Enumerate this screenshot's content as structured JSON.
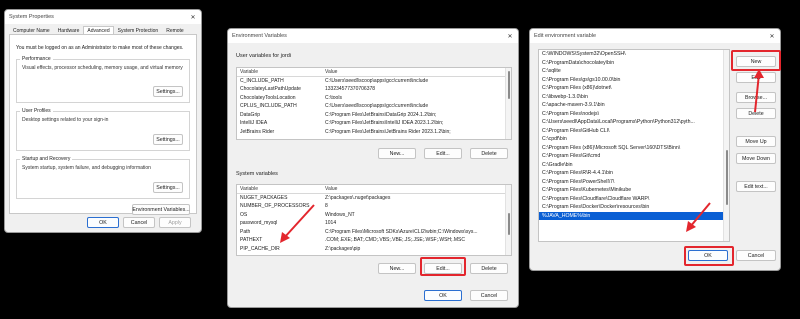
{
  "system_properties": {
    "title": "System Properties",
    "tabs": [
      "Computer Name",
      "Hardware",
      "Advanced",
      "System Protection",
      "Remote"
    ],
    "active_tab": "Advanced",
    "admin_note": "You must be logged on as an Administrator to make most of these changes.",
    "performance": {
      "title": "Performance",
      "desc": "Visual effects, processor scheduling, memory usage, and virtual memory",
      "button": "Settings..."
    },
    "user_profiles": {
      "title": "User Profiles",
      "desc": "Desktop settings related to your sign-in",
      "button": "Settings..."
    },
    "startup": {
      "title": "Startup and Recovery",
      "desc": "System startup, system failure, and debugging information",
      "button": "Settings..."
    },
    "env_button": "Environment Variables...",
    "ok": "OK",
    "cancel": "Cancel",
    "apply": "Apply"
  },
  "environment_variables": {
    "title": "Environment Variables",
    "user_label": "User variables for jordi",
    "user_headers": [
      "Variable",
      "Value"
    ],
    "user_rows": [
      [
        "C_INCLUDE_PATH",
        "C:\\Users\\seedl\\scoop\\apps\\gcc\\current\\include"
      ],
      [
        "ChocolateyLastPathUpdate",
        "133234577370706378"
      ],
      [
        "ChocolateyToolsLocation",
        "C:\\tools"
      ],
      [
        "CPLUS_INCLUDE_PATH",
        "C:\\Users\\seedl\\scoop\\apps\\gcc\\current\\include"
      ],
      [
        "DataGrip",
        "C:\\Program Files\\JetBrains\\DataGrip 2024.1.2\\bin;"
      ],
      [
        "IntelliJ IDEA",
        "C:\\Program Files\\JetBrains\\IntelliJ IDEA 2023.1.2\\bin;"
      ],
      [
        "JetBrains Rider",
        "C:\\Program Files\\JetBrains\\JetBrains Rider 2023.1.2\\bin;"
      ]
    ],
    "system_label": "System variables",
    "system_headers": [
      "Variable",
      "Value"
    ],
    "system_rows": [
      [
        "NUGET_PACKAGES",
        "Z:\\packages\\.nuget\\packages"
      ],
      [
        "NUMBER_OF_PROCESSORS",
        "8"
      ],
      [
        "OS",
        "Windows_NT"
      ],
      [
        "password_mysql",
        "1014"
      ],
      [
        "Path",
        "C:\\Program Files\\Microsoft SDKs\\Azure\\CLI2\\wbin;C:\\Windows\\sys..."
      ],
      [
        "PATHEXT",
        ".COM;.EXE;.BAT;.CMD;.VBS;.VBE;.JS;.JSE;.WSF;.WSH;.MSC"
      ],
      [
        "PIP_CACHE_DIR",
        "Z:\\packages\\pip"
      ]
    ],
    "new": "New...",
    "edit": "Edit...",
    "delete": "Delete",
    "ok": "OK",
    "cancel": "Cancel"
  },
  "edit_env": {
    "title": "Edit environment variable",
    "paths": [
      "C:\\WINDOWS\\System32\\OpenSSH\\",
      "C:\\ProgramData\\chocolatey\\bin",
      "C:\\sqlite",
      "C:\\Program Files\\gs\\gs10.00.0\\bin",
      "C:\\Program Files (x86)\\dotnet\\",
      "C:\\libwebp-1.3.0\\bin",
      "C:\\apache-maven-3.9.1\\bin",
      "C:\\Program Files\\nodejs\\",
      "C:\\Users\\seedl\\AppData\\Local\\Programs\\Python\\Python312\\pyth...",
      "C:\\Program Files\\GitHub CLI\\",
      "C:\\cpdf\\bin",
      "C:\\Program Files (x86)\\Microsoft SQL Server\\160\\DTS\\Binn\\",
      "C:\\Program Files\\Git\\cmd",
      "C:\\Gradle\\bin",
      "C:\\Program Files\\R\\R-4.4.1\\bin",
      "C:\\Program Files\\PowerShell\\7\\",
      "C:\\Program Files\\Kubernetes\\Minikube",
      "C:\\Program Files\\Cloudflare\\Cloudflare WARP\\",
      "C:\\Program Files\\Docker\\Docker\\resources\\bin",
      "%JAVA_HOME%\\bin"
    ],
    "buttons": [
      "New",
      "Edit",
      "Browse...",
      "Delete",
      "Move Up",
      "Move Down",
      "Edit text..."
    ],
    "ok": "OK",
    "cancel": "Cancel"
  },
  "colors": {
    "highlight": "#e3262d",
    "selection": "#0a5fd4"
  }
}
